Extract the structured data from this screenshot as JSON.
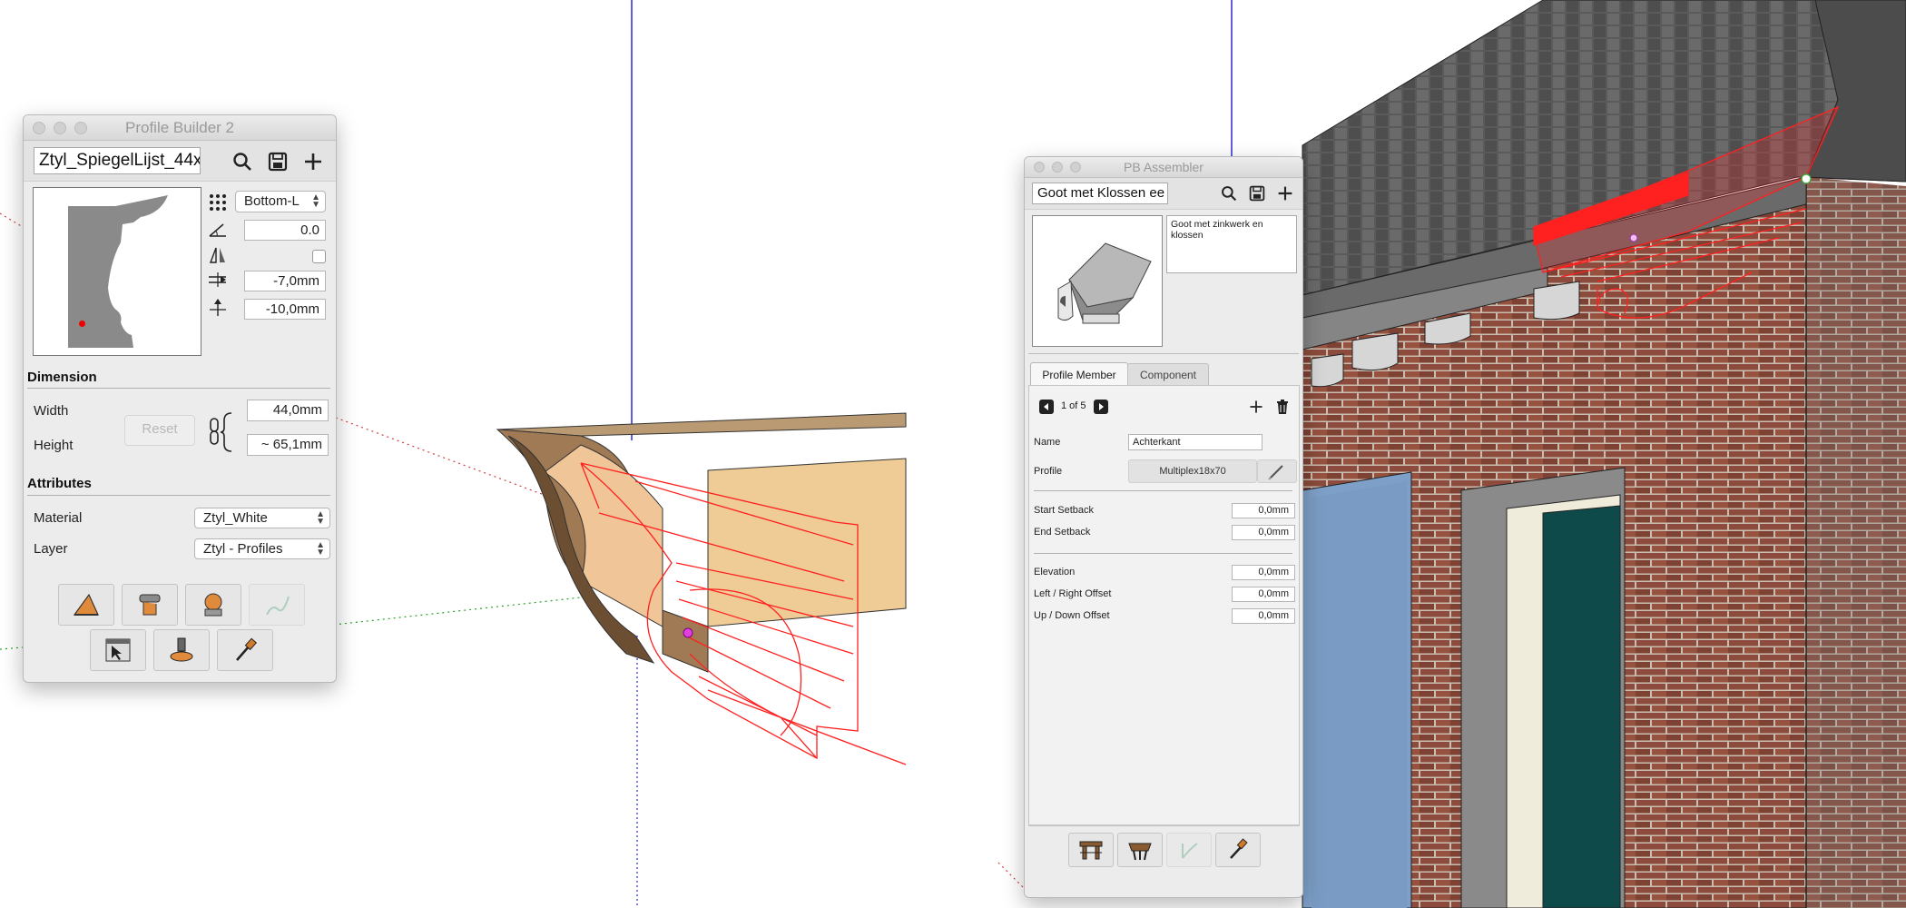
{
  "profile_builder": {
    "title": "Profile Builder 2",
    "profile_name": "Ztyl_SpiegelLijst_44x",
    "anchor": "Bottom-L",
    "rotation": "0.0",
    "offset_x": "-7,0mm",
    "offset_y": "-10,0mm",
    "dimension_title": "Dimension",
    "width_label": "Width",
    "width_value": "44,0mm",
    "height_label": "Height",
    "height_value": "~ 65,1mm",
    "reset_label": "Reset",
    "attributes_title": "Attributes",
    "material_label": "Material",
    "material_value": "Ztyl_White",
    "layer_label": "Layer",
    "layer_value": "Ztyl - Profiles"
  },
  "pb_assembler": {
    "title": "PB Assembler",
    "assembly_name": "Goot met Klossen ee",
    "description": "Goot met zinkwerk en klossen",
    "tabs": [
      "Profile Member",
      "Component"
    ],
    "pager": "1 of 5",
    "name_label": "Name",
    "name_value": "Achterkant",
    "profile_label": "Profile",
    "profile_value": "Multiplex18x70",
    "start_setback_label": "Start Setback",
    "start_setback_value": "0,0mm",
    "end_setback_label": "End Setback",
    "end_setback_value": "0,0mm",
    "elevation_label": "Elevation",
    "elevation_value": "0,0mm",
    "lr_offset_label": "Left / Right Offset",
    "lr_offset_value": "0,0mm",
    "ud_offset_label": "Up / Down Offset",
    "ud_offset_value": "0,0mm"
  },
  "colors": {
    "selection": "#ff2020",
    "wood": "#efcb95",
    "brick": "#8a4a3a",
    "roof": "#4a4a4a",
    "window_blue": "#7d9cc4",
    "window_teal": "#0e4a4a"
  }
}
